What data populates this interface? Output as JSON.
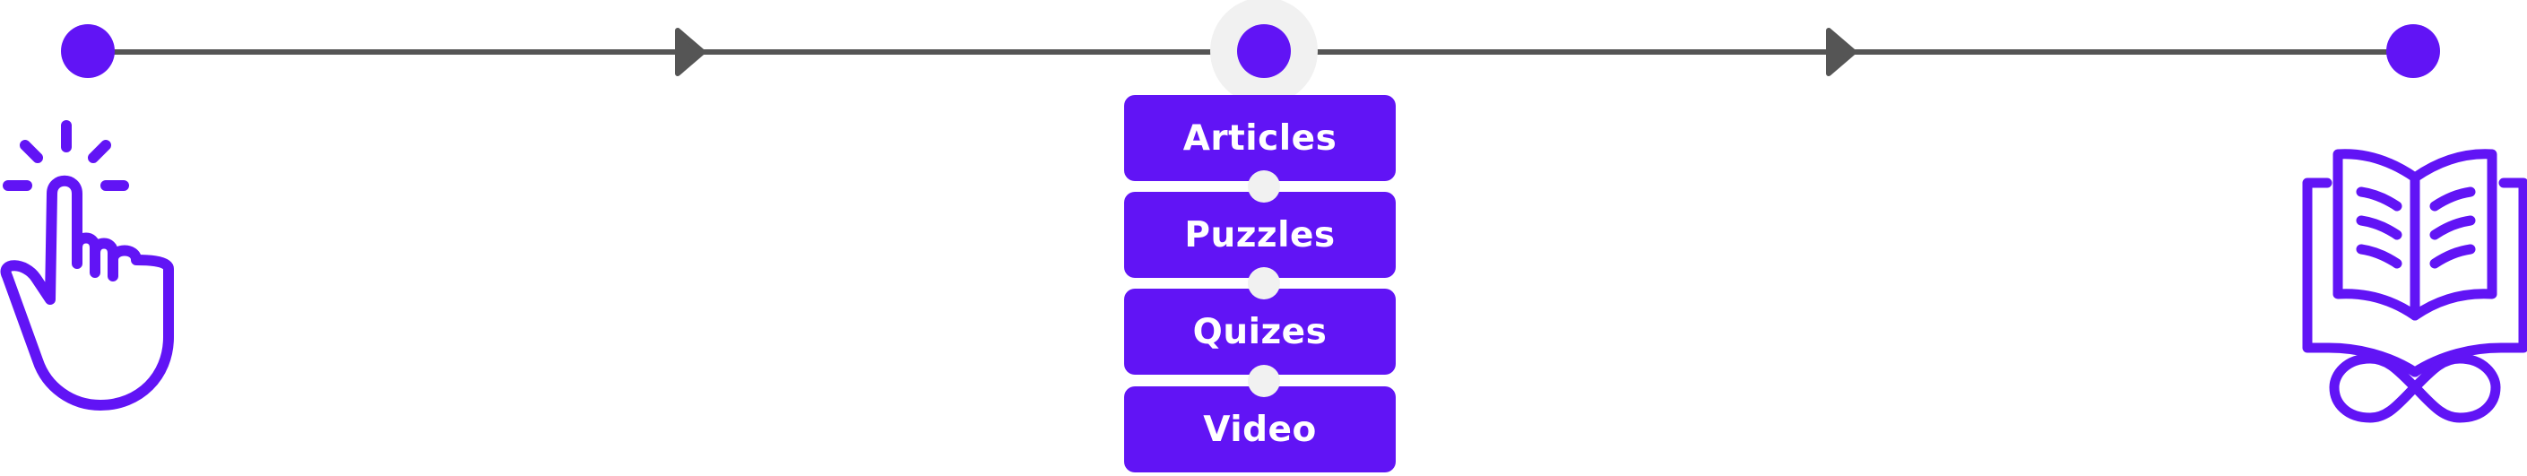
{
  "flow": {
    "steps": [
      {
        "label": "Articles"
      },
      {
        "label": "Puzzles"
      },
      {
        "label": "Quizes"
      },
      {
        "label": "Video"
      }
    ],
    "start_icon": "tap-hand-icon",
    "end_icon": "open-book-infinity-icon"
  },
  "colors": {
    "accent": "#6114f5",
    "line": "#555555",
    "halo": "#f1f1f1"
  }
}
